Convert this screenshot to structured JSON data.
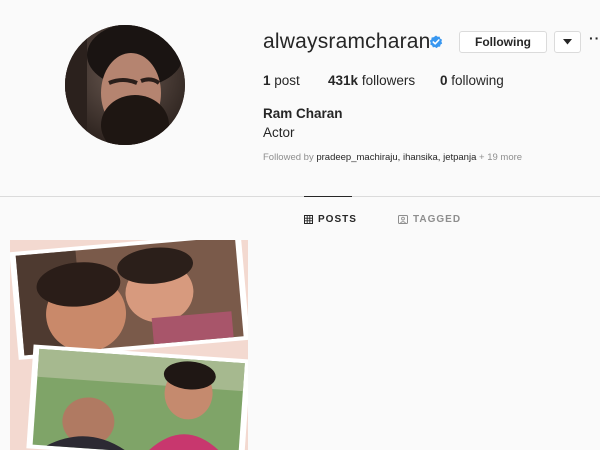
{
  "profile": {
    "username": "alwaysramcharan",
    "verified_icon": "verified-badge-icon",
    "following_label": "Following",
    "dropdown_icon": "caret-down-icon",
    "more_icon": "ellipsis-icon",
    "more_label": "···",
    "full_name": "Ram Charan",
    "bio": "Actor"
  },
  "stats": {
    "posts_count": "1",
    "posts_label": "post",
    "followers_count": "431k",
    "followers_label": "followers",
    "following_count": "0",
    "following_label": "following"
  },
  "followed_by": {
    "prefix": "Followed by",
    "names": "pradeep_machiraju, ihansika, jetpanja",
    "more": "+ 19 more"
  },
  "tabs": [
    {
      "label": "POSTS",
      "icon": "grid-icon",
      "active": true
    },
    {
      "label": "TAGGED",
      "icon": "tag-icon",
      "active": false
    }
  ],
  "colors": {
    "accent_verified": "#3897f0",
    "text_primary": "#262626",
    "text_secondary": "#8e8e8e",
    "border": "#dbdbdb",
    "background": "#fafafa"
  }
}
